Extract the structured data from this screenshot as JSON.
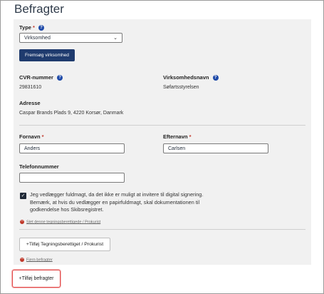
{
  "page": {
    "title": "Befragter"
  },
  "form": {
    "type": {
      "label": "Type",
      "value": "Virksomhed",
      "help": "?"
    },
    "search_button": "Fremsøg virksomhed",
    "cvr": {
      "label": "CVR-nummer",
      "value": "29831610",
      "help": "?"
    },
    "company_name": {
      "label": "Virksomhedsnavn",
      "value": "Søfartsstyrelsen",
      "help": "?"
    },
    "address": {
      "label": "Adresse",
      "value": "Caspar Brands Plads 9, 4220 Korsør, Danmark"
    },
    "first_name": {
      "label": "Fornavn",
      "value": "Anders"
    },
    "last_name": {
      "label": "Efternavn",
      "value": "Carlsen"
    },
    "phone": {
      "label": "Telefonnummer",
      "value": ""
    },
    "required_mark": "*",
    "checkbox": {
      "checked": true,
      "text": "Jeg vedlægger fuldmagt, da det ikke er muligt at invitere til digital signering. Bemærk, at hvis du vedlægger en papirfuldmagt, skal dokumentationen til godkendelse hos Skibsregistret."
    },
    "remove_signatory_link": "Slet denne tegningsberettigede / Prokurist",
    "add_signatory_button": "+Tilføj Tegningsberettiget / Prokurist",
    "remove_carrier_link": "Fjern befragter"
  },
  "footer": {
    "add_carrier_button": "+Tilføj befragter"
  },
  "colors": {
    "primary": "#1f3b6e",
    "required": "#c0392b",
    "highlight": "#e34b4b"
  }
}
